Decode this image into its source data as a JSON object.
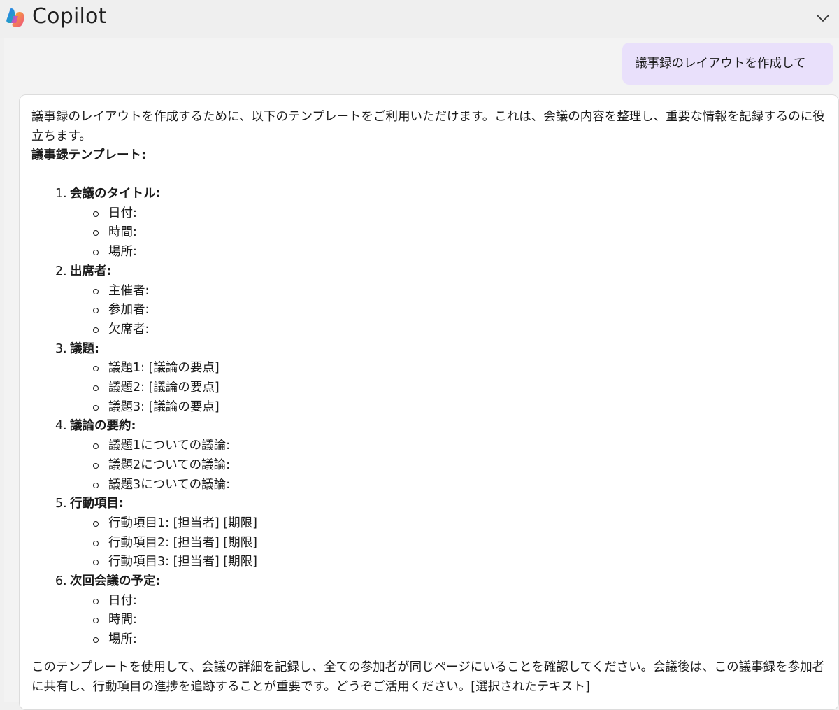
{
  "header": {
    "title": "Copilot",
    "logo_icon": "copilot-logo-icon",
    "collapse_icon": "chevron-down-icon"
  },
  "user_message": {
    "text": "議事録のレイアウトを作成して"
  },
  "assistant_message": {
    "intro": "議事録のレイアウトを作成するために、以下のテンプレートをご利用いただけます。これは、会議の内容を整理し、重要な情報を記録するのに役立ちます。",
    "template_title": "議事録テンプレート:",
    "sections": [
      {
        "number": "1.",
        "title": "会議のタイトル:",
        "items": [
          "日付:",
          "時間:",
          "場所:"
        ]
      },
      {
        "number": "2.",
        "title": "出席者:",
        "items": [
          "主催者:",
          "参加者:",
          "欠席者:"
        ]
      },
      {
        "number": "3.",
        "title": "議題:",
        "items": [
          "議題1: [議論の要点]",
          "議題2: [議論の要点]",
          "議題3: [議論の要点]"
        ]
      },
      {
        "number": "4.",
        "title": "議論の要約:",
        "items": [
          "議題1についての議論:",
          "議題2についての議論:",
          "議題3についての議論:"
        ]
      },
      {
        "number": "5.",
        "title": "行動項目:",
        "items": [
          "行動項目1: [担当者] [期限]",
          "行動項目2: [担当者] [期限]",
          "行動項目3: [担当者] [期限]"
        ]
      },
      {
        "number": "6.",
        "title": "次回会議の予定:",
        "items": [
          "日付:",
          "時間:",
          "場所:"
        ]
      }
    ],
    "outro": "このテンプレートを使用して、会議の詳細を記録し、全ての参加者が同じページにいることを確認してください。会議後は、この議事録を参加者に共有し、行動項目の進捗を追跡することが重要です。どうぞご活用ください。[選択されたテキスト]"
  },
  "colors": {
    "header_bg": "#efefef",
    "chat_bg": "#f3f3f3",
    "user_bubble_bg": "#e9e0fb",
    "card_bg": "#ffffff",
    "text": "#1b1b1b"
  }
}
